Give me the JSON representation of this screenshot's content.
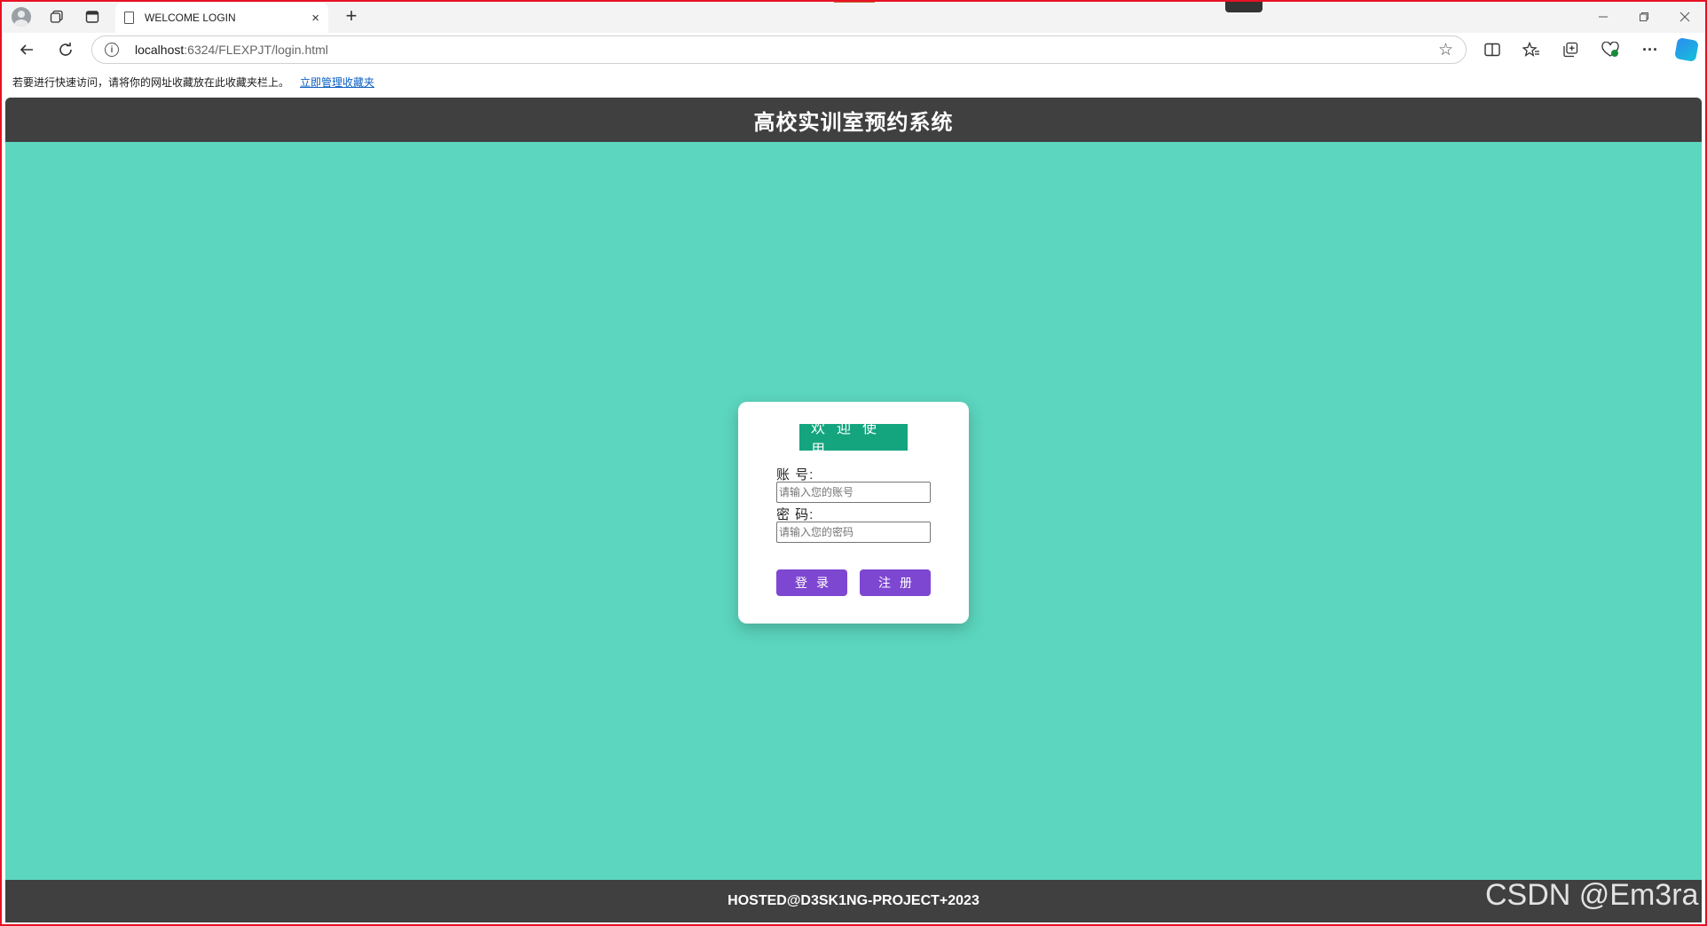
{
  "browser": {
    "tab_title": "WELCOME LOGIN",
    "tab_close": "×",
    "new_tab": "+",
    "url_host": "localhost",
    "url_path": ":6324/FLEXPJT/login.html",
    "favorites_hint": "若要进行快速访问，请将你的网址收藏放在此收藏夹栏上。",
    "favorites_link": "立即管理收藏夹"
  },
  "page": {
    "header_title": "高校实训室预约系统",
    "footer_text": "HOSTED@D3SK1NG-PROJECT+2023"
  },
  "login": {
    "welcome": "欢迎使用",
    "account_label": "账  号:",
    "account_placeholder": "请输入您的账号",
    "password_label": "密  码:",
    "password_placeholder": "请输入您的密码",
    "login_button": "登录",
    "register_button": "注册"
  },
  "watermark": "CSDN @Em3ra",
  "colors": {
    "page_background": "#5cd6be",
    "header_footer": "#404040",
    "welcome_badge": "#14a57f",
    "button": "#7e47d1"
  },
  "icons": [
    "profile-icon",
    "workspaces-icon",
    "tab-actions-icon",
    "page-icon",
    "back-icon",
    "refresh-icon",
    "info-icon",
    "favorite-star-icon",
    "split-screen-icon",
    "favorites-icon",
    "collections-icon",
    "browser-essentials-icon",
    "more-icon",
    "copilot-icon"
  ]
}
